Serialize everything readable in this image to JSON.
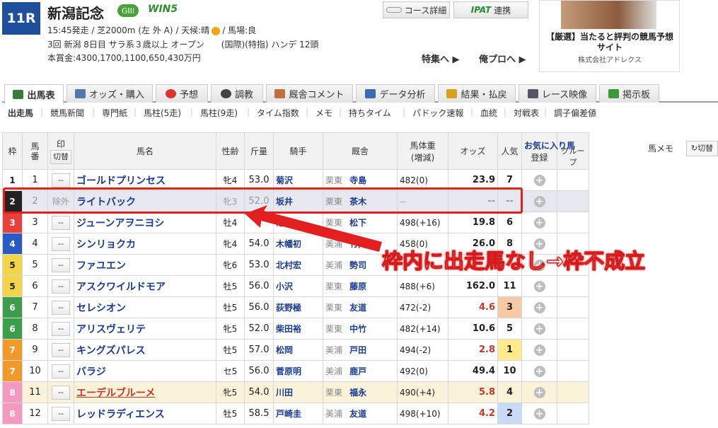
{
  "race": {
    "number": "11R",
    "name": "新潟記念",
    "grade": "GIII",
    "win5": "WIN5",
    "info1": "15:45発走 / 芝2000m (左 外 A) / 天候:晴",
    "info1b": "/ 馬場:良",
    "info2": "3回 新潟 8日目 サラ系３歳以上 オープン　　(国際)(特指) ハンデ 12頭",
    "info3": "本賞金:4300,1700,1100,650,430万円"
  },
  "buttons": {
    "course": "コース詳細",
    "ipat": "IPAT",
    "ipat_suffix": "連携",
    "tokushu": "特集へ ▶",
    "orepro": "俺プロへ ▶"
  },
  "ad": {
    "title": "【厳選】当たると評判の競馬予想サイト",
    "company": "株式会社アドレクス"
  },
  "tabs": [
    "出馬表",
    "オッズ・購入",
    "予想",
    "調教",
    "厩舎コメント",
    "データ分析",
    "結果・払戻",
    "レース映像",
    "掲示板"
  ],
  "subnav": [
    "出走馬",
    "競馬新聞",
    "専門紙",
    "馬柱(5走)",
    "馬柱(9走)",
    "タイム指数",
    "メモ",
    "持ちタイム",
    "パドック速報",
    "血統",
    "対戦表",
    "調子偏差値"
  ],
  "headers": {
    "waku": "枠",
    "umaban": "馬番",
    "mark": "印",
    "mark_btn": "切替",
    "name": "馬名",
    "sexage": "性齢",
    "weight": "斤量",
    "jockey": "騎手",
    "stable": "厩舎",
    "horse_weight": "馬体重",
    "horse_weight_sub": "(増減)",
    "odds": "オッズ",
    "pop": "人気",
    "fav": "お気に入り馬",
    "fav_reg": "登録",
    "fav_group": "グループ",
    "memo": "馬メモ",
    "memo_btn": "切替"
  },
  "horses": [
    {
      "waku": "1",
      "num": "1",
      "name": "ゴールドプリンセス",
      "sex": "牝4",
      "kin": "53.0",
      "jockey": "菊沢",
      "loc": "栗東",
      "trainer": "寺島",
      "bw": "482(0)",
      "odds": "23.9",
      "pop": "7"
    },
    {
      "waku": "2",
      "num": "2",
      "mark": "除外",
      "name": "ライトバック",
      "sex": "牝3",
      "kin": "52.0",
      "jockey": "坂井",
      "loc": "栗東",
      "trainer": "茶木",
      "bw": "--",
      "odds": "--",
      "pop": "--"
    },
    {
      "waku": "3",
      "num": "3",
      "name": "ジューンアヲニヨシ",
      "sex": "牡4",
      "kin": "5",
      "jockey": "池添",
      "loc": "栗東",
      "trainer": "松下",
      "bw": "498(+16)",
      "odds": "19.8",
      "pop": "6"
    },
    {
      "waku": "4",
      "num": "4",
      "name": "シンリョクカ",
      "sex": "牝4",
      "kin": "54.0",
      "jockey": "木幡初",
      "loc": "美浦",
      "trainer": "竹内",
      "bw": "458(0)",
      "odds": "26.0",
      "pop": "8"
    },
    {
      "waku": "5",
      "num": "5",
      "name": "ファユエン",
      "sex": "牝6",
      "kin": "53.0",
      "jockey": "北村宏",
      "loc": "美浦",
      "trainer": "勢司",
      "bw": "",
      "odds": "",
      "pop": ""
    },
    {
      "waku": "5",
      "num": "6",
      "name": "アスクワイルドモア",
      "sex": "牡5",
      "kin": "56.0",
      "jockey": "小沢",
      "loc": "栗東",
      "trainer": "藤原",
      "bw": "488(+6)",
      "odds": "162.0",
      "pop": "11"
    },
    {
      "waku": "6",
      "num": "7",
      "name": "セレシオン",
      "sex": "牡5",
      "kin": "56.0",
      "jockey": "荻野極",
      "loc": "栗東",
      "trainer": "友道",
      "bw": "472(-2)",
      "odds": "4.6",
      "pop": "3"
    },
    {
      "waku": "6",
      "num": "8",
      "name": "アリスヴェリテ",
      "sex": "牝5",
      "kin": "52.0",
      "jockey": "柴田裕",
      "loc": "栗東",
      "trainer": "中竹",
      "bw": "482(+14)",
      "odds": "10.6",
      "pop": "5"
    },
    {
      "waku": "7",
      "num": "9",
      "name": "キングズパレス",
      "sex": "牡5",
      "kin": "57.0",
      "jockey": "松岡",
      "loc": "美浦",
      "trainer": "戸田",
      "bw": "494(-2)",
      "odds": "2.8",
      "pop": "1"
    },
    {
      "waku": "7",
      "num": "10",
      "name": "バラジ",
      "sex": "セ5",
      "kin": "56.0",
      "jockey": "菅原明",
      "loc": "美浦",
      "trainer": "鹿戸",
      "bw": "492(0)",
      "odds": "49.4",
      "pop": "10"
    },
    {
      "waku": "8",
      "num": "11",
      "name": "エーデルブルーメ",
      "sex": "牝5",
      "kin": "54.0",
      "jockey": "川田",
      "loc": "栗東",
      "trainer": "福永",
      "bw": "490(+4)",
      "odds": "5.8",
      "pop": "4"
    },
    {
      "waku": "8",
      "num": "12",
      "name": "レッドラディエンス",
      "sex": "牡5",
      "kin": "58.5",
      "jockey": "戸崎圭",
      "loc": "美浦",
      "trainer": "友道",
      "bw": "498(+10)",
      "odds": "4.2",
      "pop": "2"
    }
  ],
  "annotation": "枠内に出走馬なし→枠不成立",
  "colors": {
    "waku1": "#ffffff",
    "waku2": "#222222",
    "waku3": "#e8413c",
    "waku4": "#2a5bc4",
    "waku5": "#f3d54a",
    "waku6": "#3a9e4a",
    "waku7": "#f19a2a",
    "waku8": "#f49ac1",
    "accent": "#1f4f9c",
    "annotation": "#d41c1c"
  }
}
